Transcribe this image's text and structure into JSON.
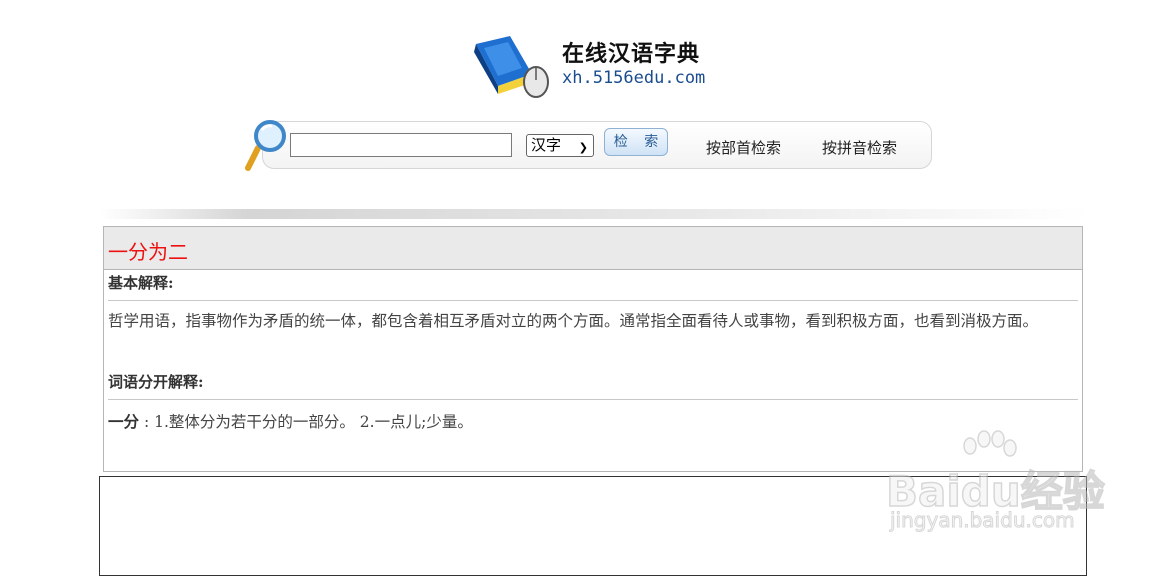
{
  "logo": {
    "title": "在线汉语字典",
    "url": "xh.5156edu.com"
  },
  "search": {
    "input_value": "",
    "type_selected": "汉字",
    "button_label": "检 索",
    "link_radical": "按部首检索",
    "link_pinyin": "按拼音检索"
  },
  "entry": {
    "word": "一分为二",
    "basic_label": "基本解释:",
    "basic_text": "哲学用语，指事物作为矛盾的统一体，都包含着相互矛盾对立的两个方面。通常指全面看待人或事物，看到积极方面，也看到消极方面。",
    "split_label": "词语分开解释:",
    "split_term": "一分",
    "split_sep": " : ",
    "split_text": "1.整体分为若干分的一部分。 2.一点儿;少量。"
  },
  "watermark": {
    "brand": "Baidu经验",
    "url": "jingyan.baidu.com"
  },
  "icons": {
    "logo": "dictionary-book-icon",
    "search": "magnifier-icon",
    "select": "chevron-down-icon",
    "watermark": "baidu-paw-icon"
  }
}
